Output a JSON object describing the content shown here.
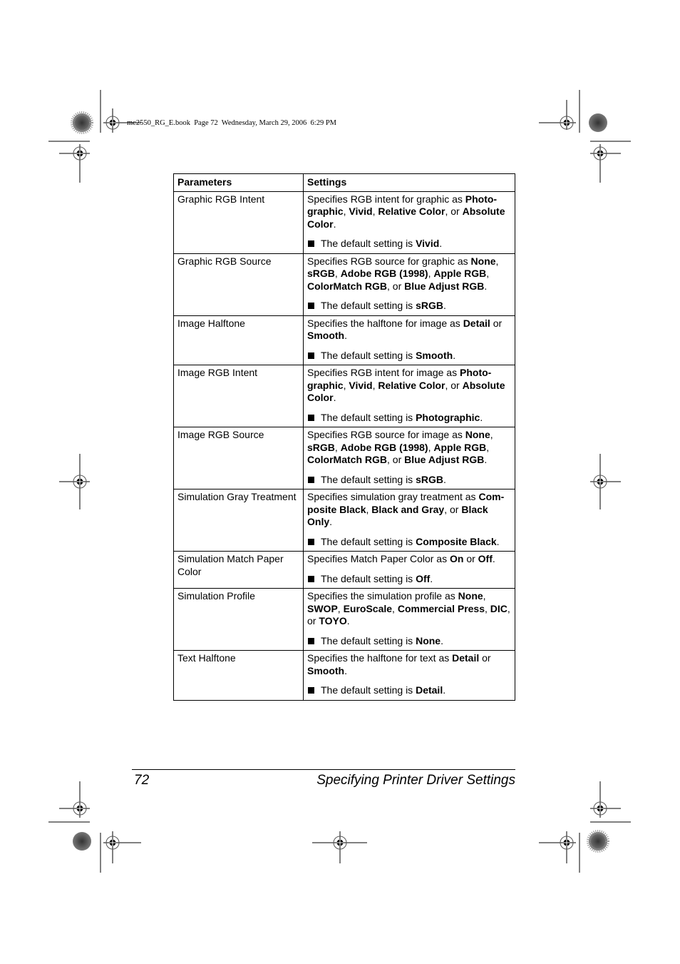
{
  "header": {
    "print_info": "mc2550_RG_E.book  Page 72  Wednesday, March 29, 2006  6:29 PM"
  },
  "table": {
    "columns": [
      "Parameters",
      "Settings"
    ],
    "default_prefix": "The default setting is ",
    "rows": [
      {
        "parameter": "Graphic RGB Intent",
        "description": [
          {
            "t": "Specifies RGB intent for graphic as "
          },
          {
            "t": "Photo-graphic",
            "b": true
          },
          {
            "t": ", "
          },
          {
            "t": "Vivid",
            "b": true
          },
          {
            "t": ", "
          },
          {
            "t": "Relative Color",
            "b": true
          },
          {
            "t": ", or "
          },
          {
            "t": "Absolute Color",
            "b": true
          },
          {
            "t": "."
          }
        ],
        "default": "Vivid"
      },
      {
        "parameter": "Graphic RGB Source",
        "description": [
          {
            "t": "Specifies RGB source for graphic as "
          },
          {
            "t": "None",
            "b": true
          },
          {
            "t": ", "
          },
          {
            "t": "sRGB",
            "b": true
          },
          {
            "t": ", "
          },
          {
            "t": "Adobe RGB (1998)",
            "b": true
          },
          {
            "t": ", "
          },
          {
            "t": "Apple RGB",
            "b": true
          },
          {
            "t": ", "
          },
          {
            "t": "ColorMatch RGB",
            "b": true
          },
          {
            "t": ", or "
          },
          {
            "t": "Blue Adjust RGB",
            "b": true
          },
          {
            "t": "."
          }
        ],
        "default": "sRGB"
      },
      {
        "parameter": "Image Halftone",
        "description": [
          {
            "t": "Specifies the halftone for image as "
          },
          {
            "t": "Detail",
            "b": true
          },
          {
            "t": " or "
          },
          {
            "t": "Smooth",
            "b": true
          },
          {
            "t": "."
          }
        ],
        "default": "Smooth"
      },
      {
        "parameter": "Image RGB Intent",
        "description": [
          {
            "t": "Specifies RGB intent for image as "
          },
          {
            "t": "Photo-graphic",
            "b": true
          },
          {
            "t": ", "
          },
          {
            "t": "Vivid",
            "b": true
          },
          {
            "t": ", "
          },
          {
            "t": "Relative Color",
            "b": true
          },
          {
            "t": ", or "
          },
          {
            "t": "Absolute Color",
            "b": true
          },
          {
            "t": "."
          }
        ],
        "default": "Photographic"
      },
      {
        "parameter": "Image RGB Source",
        "description": [
          {
            "t": "Specifies RGB source for image as "
          },
          {
            "t": "None",
            "b": true
          },
          {
            "t": ", "
          },
          {
            "t": "sRGB",
            "b": true
          },
          {
            "t": ", "
          },
          {
            "t": "Adobe RGB (1998)",
            "b": true
          },
          {
            "t": ", "
          },
          {
            "t": "Apple RGB",
            "b": true
          },
          {
            "t": ", "
          },
          {
            "t": "ColorMatch RGB",
            "b": true
          },
          {
            "t": ", or "
          },
          {
            "t": "Blue Adjust RGB",
            "b": true
          },
          {
            "t": "."
          }
        ],
        "default": "sRGB"
      },
      {
        "parameter": "Simulation Gray Treatment",
        "description": [
          {
            "t": "Specifies simulation gray treatment as "
          },
          {
            "t": "Com-posite Black",
            "b": true
          },
          {
            "t": ", "
          },
          {
            "t": "Black and Gray",
            "b": true
          },
          {
            "t": ", or "
          },
          {
            "t": "Black Only",
            "b": true
          },
          {
            "t": "."
          }
        ],
        "default": "Composite Black"
      },
      {
        "parameter": "Simulation Match Paper Color",
        "description": [
          {
            "t": "Specifies Match Paper Color as "
          },
          {
            "t": "On",
            "b": true
          },
          {
            "t": " or "
          },
          {
            "t": "Off",
            "b": true
          },
          {
            "t": "."
          }
        ],
        "default": "Off"
      },
      {
        "parameter": "Simulation Profile",
        "description": [
          {
            "t": "Specifies the simulation profile as "
          },
          {
            "t": "None",
            "b": true
          },
          {
            "t": ", "
          },
          {
            "t": "SWOP",
            "b": true
          },
          {
            "t": ", "
          },
          {
            "t": "EuroScale",
            "b": true
          },
          {
            "t": ", "
          },
          {
            "t": "Commercial Press",
            "b": true
          },
          {
            "t": ", "
          },
          {
            "t": "DIC",
            "b": true
          },
          {
            "t": ", or "
          },
          {
            "t": "TOYO",
            "b": true
          },
          {
            "t": "."
          }
        ],
        "default": "None"
      },
      {
        "parameter": "Text Halftone",
        "description": [
          {
            "t": "Specifies the halftone for text as "
          },
          {
            "t": "Detail",
            "b": true
          },
          {
            "t": " or "
          },
          {
            "t": "Smooth",
            "b": true
          },
          {
            "t": "."
          }
        ],
        "default": "Detail"
      }
    ]
  },
  "footer": {
    "page_number": "72",
    "chapter_title": "Specifying Printer Driver Settings"
  },
  "icons": {
    "registration_mark": "crosshair-circle",
    "color_target": "radial-star-target"
  }
}
